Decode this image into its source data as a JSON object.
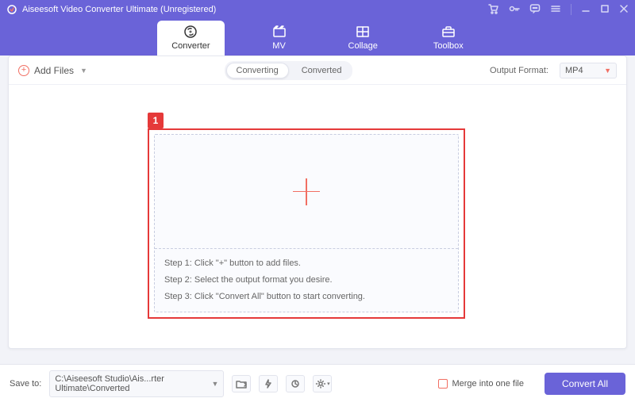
{
  "title": "Aiseesoft Video Converter Ultimate (Unregistered)",
  "nav": {
    "tabs": [
      {
        "label": "Converter"
      },
      {
        "label": "MV"
      },
      {
        "label": "Collage"
      },
      {
        "label": "Toolbox"
      }
    ]
  },
  "toolbar": {
    "add_files_label": "Add Files",
    "tabs": {
      "converting": "Converting",
      "converted": "Converted"
    },
    "output_format_label": "Output Format:",
    "output_format_value": "MP4"
  },
  "dropzone": {
    "steps": [
      "Step 1: Click \"+\" button to add files.",
      "Step 2: Select the output format you desire.",
      "Step 3: Click \"Convert All\" button to start converting."
    ]
  },
  "bottom": {
    "save_to_label": "Save to:",
    "save_to_path": "C:\\Aiseesoft Studio\\Ais...rter Ultimate\\Converted",
    "merge_label": "Merge into one file",
    "convert_all_label": "Convert All"
  },
  "annotation": {
    "badge": "1"
  }
}
